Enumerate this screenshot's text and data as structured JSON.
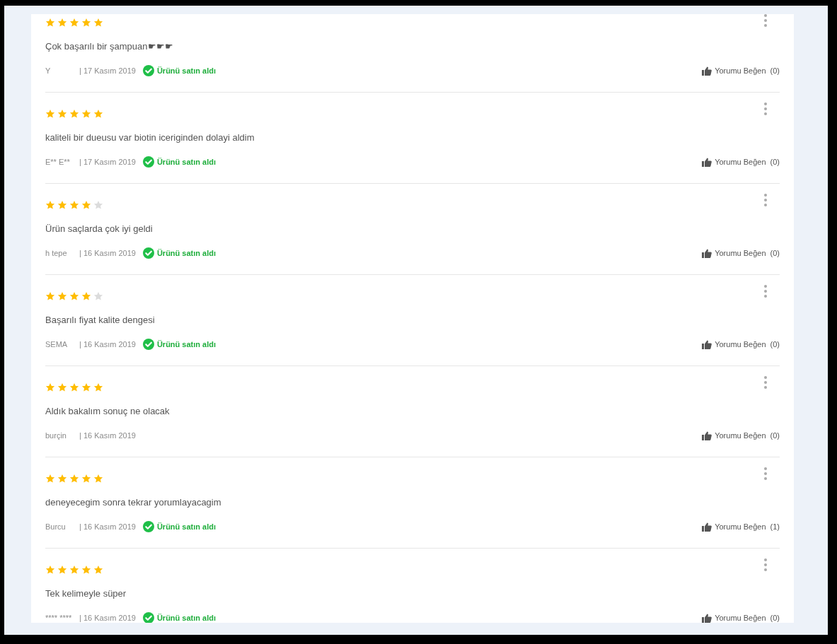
{
  "reviews": [
    {
      "stars": 5,
      "text": "Çok başarılı bir şampuan☛☛☛",
      "author": "Y",
      "date": "| 17 Kasım 2019",
      "verified": true,
      "verified_label": "Ürünü satın aldı",
      "like_label": "Yorumu Beğen",
      "like_count": "(0)"
    },
    {
      "stars": 5,
      "text": "kaliteli bir dueusu var biotin iceriginden dolayi aldim",
      "author": "E** E**",
      "date": "| 17 Kasım 2019",
      "verified": true,
      "verified_label": "Ürünü satın aldı",
      "like_label": "Yorumu Beğen",
      "like_count": "(0)"
    },
    {
      "stars": 4,
      "text": "Ürün saçlarda çok iyi geldi",
      "author": "h tepe",
      "date": "| 16 Kasım 2019",
      "verified": true,
      "verified_label": "Ürünü satın aldı",
      "like_label": "Yorumu Beğen",
      "like_count": "(0)"
    },
    {
      "stars": 4,
      "text": "Başarılı fiyat kalite dengesi",
      "author": "SEMA",
      "date": "| 16 Kasım 2019",
      "verified": true,
      "verified_label": "Ürünü satın aldı",
      "like_label": "Yorumu Beğen",
      "like_count": "(0)"
    },
    {
      "stars": 5,
      "text": "Aldık bakalım sonuç ne olacak",
      "author": "burçin",
      "date": "| 16 Kasım 2019",
      "verified": false,
      "like_label": "Yorumu Beğen",
      "like_count": "(0)"
    },
    {
      "stars": 5,
      "text": "deneyecegim sonra tekrar yorumlayacagim",
      "author": "Burcu",
      "date": "| 16 Kasım 2019",
      "verified": true,
      "verified_label": "Ürünü satın aldı",
      "like_label": "Yorumu Beğen",
      "like_count": "(1)"
    },
    {
      "stars": 5,
      "text": "Tek kelimeyle süper",
      "author": "**** ****",
      "date": "| 16 Kasım 2019",
      "verified": true,
      "verified_label": "Ürünü satın aldı",
      "like_label": "Yorumu Beğen",
      "like_count": "(0)"
    }
  ]
}
